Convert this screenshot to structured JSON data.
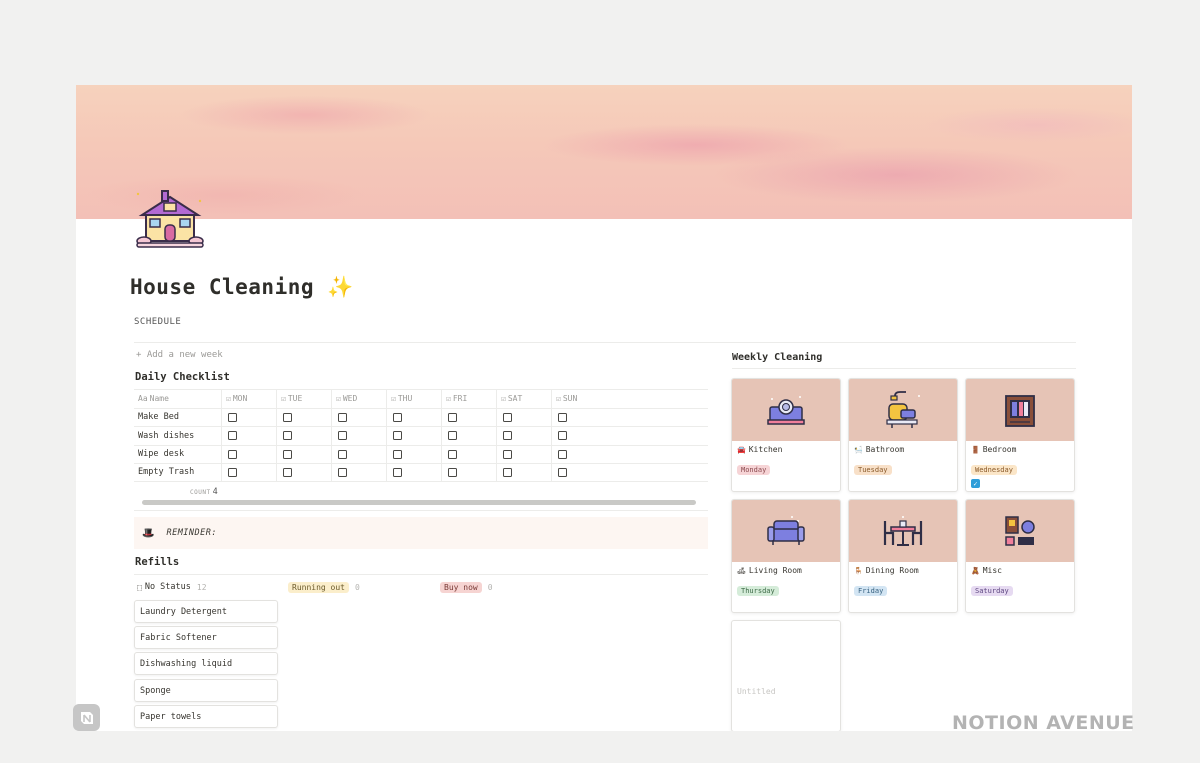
{
  "page": {
    "title": "House Cleaning",
    "title_emoji": "✨",
    "schedule_label": "SCHEDULE"
  },
  "schedule": {
    "add_week": "+ Add a new week",
    "daily_heading": "Daily Checklist",
    "columns": [
      "Name",
      "MON",
      "TUE",
      "WED",
      "THU",
      "FRI",
      "SAT",
      "SUN"
    ],
    "rows": [
      {
        "name": "Make Bed"
      },
      {
        "name": "Wash dishes"
      },
      {
        "name": "Wipe desk"
      },
      {
        "name": "Empty Trash"
      }
    ],
    "count_label": "COUNT",
    "count_value": "4"
  },
  "reminder": {
    "icon": "🎩",
    "text": "REMINDER:"
  },
  "refills": {
    "heading": "Refills",
    "groups": [
      {
        "label": "No Status",
        "count": "12",
        "color": "none"
      },
      {
        "label": "Running out",
        "count": "0",
        "color": "#fbeecb"
      },
      {
        "label": "Buy now",
        "count": "0",
        "color": "#f6d4d2"
      }
    ],
    "items": [
      "Laundry Detergent",
      "Fabric Softener",
      "Dishwashing liquid",
      "Sponge",
      "Paper towels"
    ]
  },
  "weekly": {
    "heading": "Weekly Cleaning",
    "cards": [
      {
        "name": "Kitchen",
        "day": "Monday",
        "icon": "kitchen-sink-icon",
        "emoji": "🚘"
      },
      {
        "name": "Bathroom",
        "day": "Tuesday",
        "icon": "bathtub-icon",
        "emoji": "🛀"
      },
      {
        "name": "Bedroom",
        "day": "Wednesday",
        "icon": "wardrobe-icon",
        "emoji": "🚪",
        "checked": true
      },
      {
        "name": "Living Room",
        "day": "Thursday",
        "icon": "sofa-icon",
        "emoji": "🛋"
      },
      {
        "name": "Dining Room",
        "day": "Friday",
        "icon": "dining-table-icon",
        "emoji": "🪑"
      },
      {
        "name": "Misc",
        "day": "Saturday",
        "icon": "misc-items-icon",
        "emoji": "🧸"
      }
    ],
    "untitled": "Untitled"
  },
  "brand": "NOTION AVENUE",
  "colors": {
    "cover_top": "#f6d2bd",
    "cover_clouds": "#ee9fb0",
    "card_image_bg": "#e6c4b6",
    "checkbox_checked": "#2f9ed9"
  }
}
